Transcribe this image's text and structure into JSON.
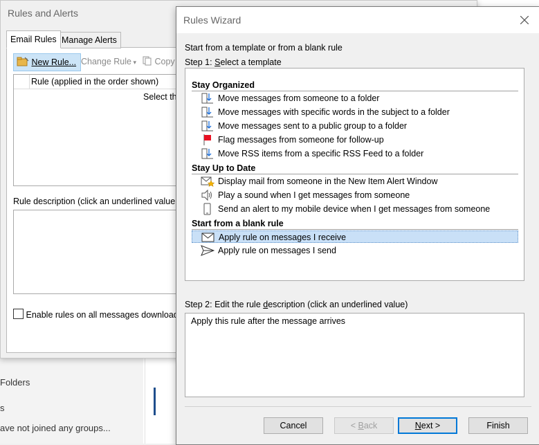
{
  "background": {
    "folders_label": "Folders",
    "section_label": "s",
    "groups_text": "ave not joined any groups..."
  },
  "rules_alerts": {
    "title": "Rules and Alerts",
    "tabs": [
      {
        "label": "Email Rules",
        "active": true
      },
      {
        "label": "Manage Alerts",
        "active": false
      }
    ],
    "toolbar": {
      "new_rule": "New Rule...",
      "change_rule": "Change Rule",
      "copy": "Copy"
    },
    "rule_list_header": "Rule (applied in the order shown)",
    "select_text": "Select th",
    "description_label": "Rule description (click an underlined value",
    "enable_label": "Enable rules on all messages download"
  },
  "wizard": {
    "title": "Rules Wizard",
    "intro": "Start from a template or from a blank rule",
    "step1_label": "Step 1: Select a template",
    "groups": [
      {
        "name": "Stay Organized",
        "items": [
          {
            "icon": "move-to-folder-icon",
            "label": "Move messages from someone to a folder"
          },
          {
            "icon": "move-to-folder-icon",
            "label": "Move messages with specific words in the subject to a folder"
          },
          {
            "icon": "move-to-folder-icon",
            "label": "Move messages sent to a public group to a folder"
          },
          {
            "icon": "red-flag-icon",
            "label": "Flag messages from someone for follow-up"
          },
          {
            "icon": "move-to-folder-icon",
            "label": "Move RSS items from a specific RSS Feed to a folder"
          }
        ]
      },
      {
        "name": "Stay Up to Date",
        "items": [
          {
            "icon": "new-item-alert-icon",
            "label": "Display mail from someone in the New Item Alert Window"
          },
          {
            "icon": "speaker-icon",
            "label": "Play a sound when I get messages from someone"
          },
          {
            "icon": "mobile-device-icon",
            "label": "Send an alert to my mobile device when I get messages from someone"
          }
        ]
      },
      {
        "name": "Start from a blank rule",
        "items": [
          {
            "icon": "envelope-icon",
            "label": "Apply rule on messages I receive",
            "selected": true
          },
          {
            "icon": "send-arrow-icon",
            "label": "Apply rule on messages I send"
          }
        ]
      }
    ],
    "step2_label": "Step 2: Edit the rule description (click an underlined value)",
    "description_text": "Apply this rule after the message arrives",
    "buttons": {
      "cancel": "Cancel",
      "back": "< Back",
      "next": "Next >",
      "finish": "Finish"
    }
  }
}
